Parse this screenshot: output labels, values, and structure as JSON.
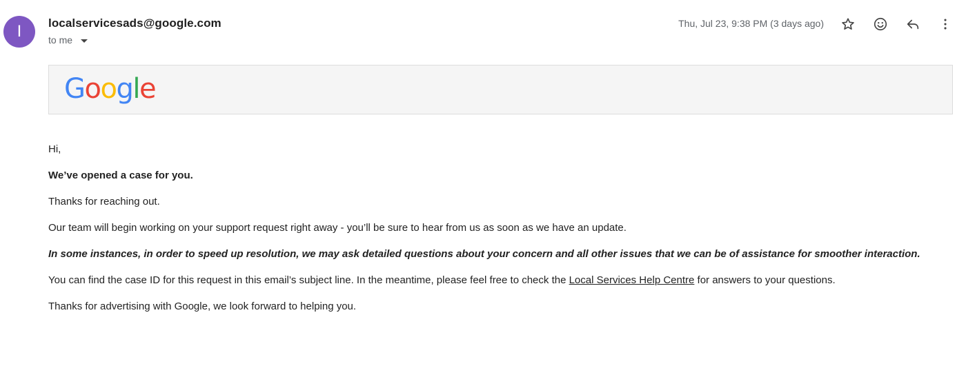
{
  "header": {
    "avatar_letter": "I",
    "sender": "localservicesads@google.com",
    "recipient": "to me",
    "timestamp": "Thu, Jul 23, 9:38 PM (3 days ago)",
    "icons": [
      "star-icon",
      "emoji-icon",
      "reply-icon",
      "more-vert-icon"
    ],
    "avatar_color": "#7e57c2"
  },
  "banner": {
    "logo_letters": [
      "G",
      "o",
      "o",
      "g",
      "l",
      "e"
    ],
    "logo_colors": [
      "#4285F4",
      "#EA4335",
      "#FBBC05",
      "#4285F4",
      "#34A853",
      "#EA4335"
    ]
  },
  "email": {
    "greeting": "Hi,",
    "headline": "We’ve opened a case for you.",
    "thanks": "Thanks for reaching out.",
    "team": "Our team will begin working on your support request right away - you’ll be sure to hear from us as soon as we have an update.",
    "instances": "In some instances, in order to speed up resolution, we may ask detailed questions about your concern and all other issues that we can be of assistance for smoother interaction.",
    "case_prefix": "You can find the case ID for this request in this email’s subject line. In the meantime, please feel free to check the ",
    "case_link": "Local Services Help Centre",
    "case_suffix": " for answers to your questions.",
    "closing": "Thanks for advertising with Google, we look forward to helping you."
  }
}
